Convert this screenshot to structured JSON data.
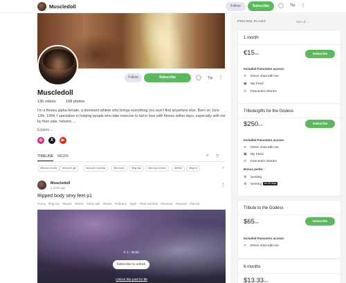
{
  "topbar": {
    "username": "Muscledoll",
    "follow_label": "Follow",
    "subscribe_label": "Subscribe",
    "tip_label": "Tip"
  },
  "profile": {
    "display_name": "Muscledoll",
    "videos": "136 videos",
    "photos": "168 photos",
    "follow_label": "Follow",
    "subscribe_label": "Subscribe",
    "tip_label": "Tip",
    "bio": "I'm a fitness alpha female, a dominant athlete who brings everything you won't find anywhere else. Born on June 12th, 1994, I specialize in helping people who take exercise to fall in love with fitness within days, especially with me by their side, hehehe....",
    "expand_label": "Expand ⌄",
    "social": [
      {
        "name": "instagram",
        "glyph": "◎",
        "color": "#d62976"
      },
      {
        "name": "x",
        "glyph": "X",
        "color": "#111111"
      },
      {
        "name": "youtube",
        "glyph": "▶",
        "color": "#e62117"
      }
    ]
  },
  "tabs": {
    "timeline": "TIMELINE",
    "media": "MEDIA"
  },
  "tags": [
    "#fitness model",
    "#muscle girl",
    "#muscle worship",
    "#femdom",
    "#big ass",
    "#strong woman",
    "#fetish",
    "#big bo"
  ],
  "post": {
    "author": "Muscledoll",
    "time": "1 week ago",
    "title": "Ripped body sexy feet p1",
    "tags": [
      "#sexy",
      "#big ass",
      "#twerk",
      "#fetish",
      "#dirty talk",
      "#tease",
      "#vibrator",
      "#pph",
      "#feet worship",
      "#domme",
      "#spread",
      "#fanvid"
    ],
    "media_info": "① 1 : 30:00",
    "unlock_label": "Subscribe to unlock",
    "unlock_link": "Unlock this post for $8"
  },
  "pricing": {
    "header": "PRICING PLANS",
    "see_all": "See all ⌄",
    "plans": [
      {
        "title": "1 month",
        "price": "€15",
        "per": "/mo",
        "subscribe_label": "Subscribe",
        "access_header": "Included Fancentro access:",
        "features": [
          "Direct chat with me",
          "My Feed",
          "Fancentro Stories"
        ]
      },
      {
        "title": "Tribute/gifts for the Godess",
        "price": "$250",
        "per": "/mo",
        "subscribe_label": "Subscribe",
        "access_header": "Included Fancentro access:",
        "features": [
          "Direct chat with me",
          "My Feed",
          "Fancentro Stories"
        ],
        "bonus_header": "Bonus perks:",
        "bonus": [
          "Sexting",
          "Sexting"
        ],
        "bonus_badge": "for 30 days"
      },
      {
        "title": "Tribute to the Godess",
        "price": "$65",
        "per": "/mo",
        "subscribe_label": "Subscribe",
        "access_header": "Included Fancentro access:",
        "features": [
          "Direct chat with me"
        ]
      },
      {
        "title": "6 months",
        "price": "$13.33",
        "per": "/mo"
      }
    ]
  },
  "colors": {
    "accent_green": "#5cb85c",
    "follow_bg": "#e7e3f3"
  }
}
